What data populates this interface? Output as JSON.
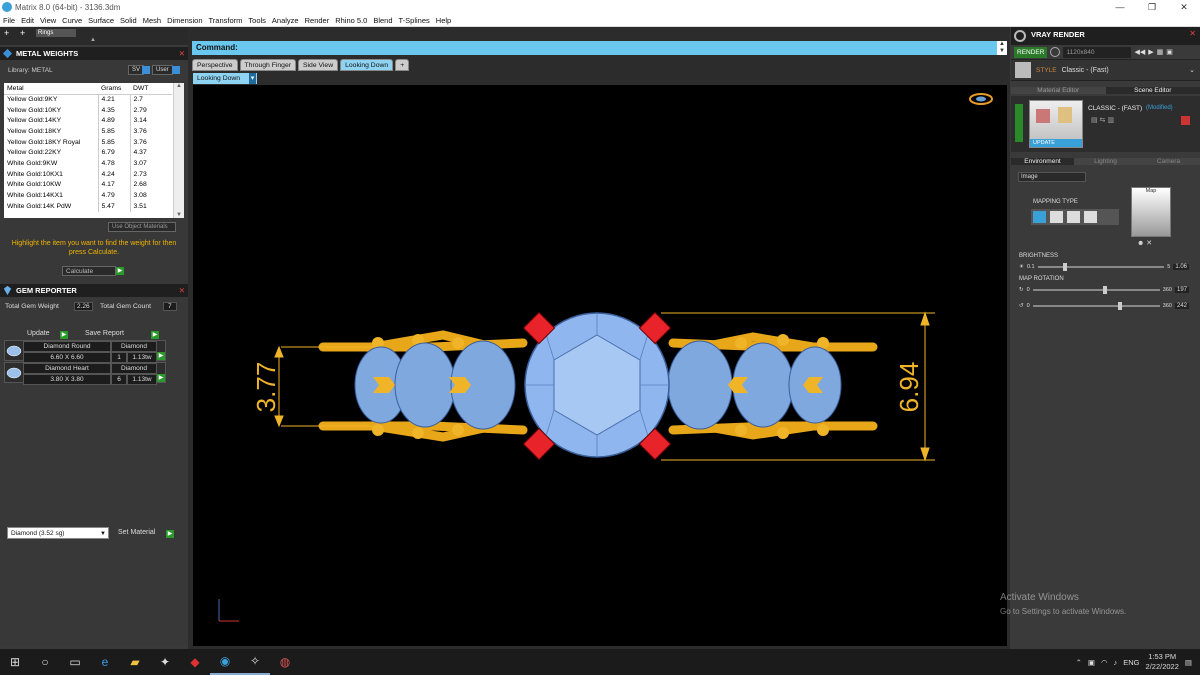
{
  "window": {
    "title": "Matrix 8.0 (64-bit) - 3136.3dm",
    "minimize": "—",
    "maximize": "❐",
    "close": "✕"
  },
  "menu": [
    "File",
    "Edit",
    "View",
    "Curve",
    "Surface",
    "Solid",
    "Mesh",
    "Dimension",
    "Transform",
    "Tools",
    "Analyze",
    "Render",
    "Rhino 5.0",
    "Blend",
    "T-Splines",
    "Help"
  ],
  "top_strip": {
    "field": "Rings"
  },
  "metal_weights": {
    "title": "METAL WEIGHTS",
    "library_label": "Library: METAL",
    "btn_sv": "SV",
    "btn_user": "User",
    "columns": [
      "Metal",
      "Grams",
      "DWT"
    ],
    "rows": [
      [
        "Yellow Gold:9KY",
        "4.21",
        "2.7"
      ],
      [
        "Yellow Gold:10KY",
        "4.35",
        "2.79"
      ],
      [
        "Yellow Gold:14KY",
        "4.89",
        "3.14"
      ],
      [
        "Yellow Gold:18KY",
        "5.85",
        "3.76"
      ],
      [
        "Yellow Gold:18KY Royal",
        "5.85",
        "3.76"
      ],
      [
        "Yellow Gold:22KY",
        "6.79",
        "4.37"
      ],
      [
        "White Gold:9KW",
        "4.78",
        "3.07"
      ],
      [
        "White Gold:10KX1",
        "4.24",
        "2.73"
      ],
      [
        "White Gold:10KW",
        "4.17",
        "2.68"
      ],
      [
        "White Gold:14KX1",
        "4.79",
        "3.08"
      ],
      [
        "White Gold:14K PdW",
        "5.47",
        "3.51"
      ]
    ],
    "use_object_materials": "Use Object Materials",
    "hint": "Highlight the item you want to find the weight for then press Calculate.",
    "calculate": "Calculate"
  },
  "gem_reporter": {
    "title": "GEM REPORTER",
    "total_weight_label": "Total Gem Weight",
    "total_weight": "2.26",
    "total_count_label": "Total Gem Count",
    "total_count": "7",
    "update": "Update",
    "save_report": "Save Report",
    "gems": [
      {
        "shape": "Diamond Round",
        "size": "6.60 X 6.60",
        "material": "Diamond",
        "count": "1",
        "weight": "1.13tw"
      },
      {
        "shape": "Diamond Heart",
        "size": "3.80 X 3.80",
        "material": "Diamond",
        "count": "6",
        "weight": "1.13tw"
      }
    ],
    "material_select": "Diamond    (3.52 sg)",
    "set_material": "Set Material"
  },
  "command": {
    "label": "Command:"
  },
  "viewport_tabs": [
    "Perspective",
    "Through Finger",
    "Side View",
    "Looking Down"
  ],
  "active_view": "Looking Down",
  "dimensions": {
    "left": "3.77",
    "right": "6.94"
  },
  "vray": {
    "title": "VRAY RENDER",
    "render": "RENDER",
    "resolution": "1120x840",
    "style_label": "STYLE",
    "style_value": "Classic - (Fast)",
    "tabs": [
      "Material Editor",
      "Scene Editor"
    ],
    "preset": "CLASSIC - (FAST)",
    "modified": "(Modified)",
    "update": "UPDATE",
    "subtabs": [
      "Environment",
      "Lighting",
      "Camera"
    ],
    "env_select": "Image",
    "mapping_type": "MAPPING TYPE",
    "map_label": "Map",
    "brightness_label": "BRIGHTNESS",
    "brightness_min": "0.1",
    "brightness_max": "5",
    "brightness_value": "1.06",
    "brightness_level": 0.2,
    "rotation_label": "MAP ROTATION",
    "rot1_min": "0",
    "rot1_max": "360",
    "rot1_value": "197",
    "rot1_level": 0.55,
    "rot2_min": "0",
    "rot2_max": "360",
    "rot2_value": "242",
    "rot2_level": 0.67
  },
  "watermark": {
    "line1": "Activate Windows",
    "line2": "Go to Settings to activate Windows."
  },
  "taskbar": {
    "lang": "ENG",
    "time": "1:53 PM",
    "date": "2/22/2022"
  }
}
